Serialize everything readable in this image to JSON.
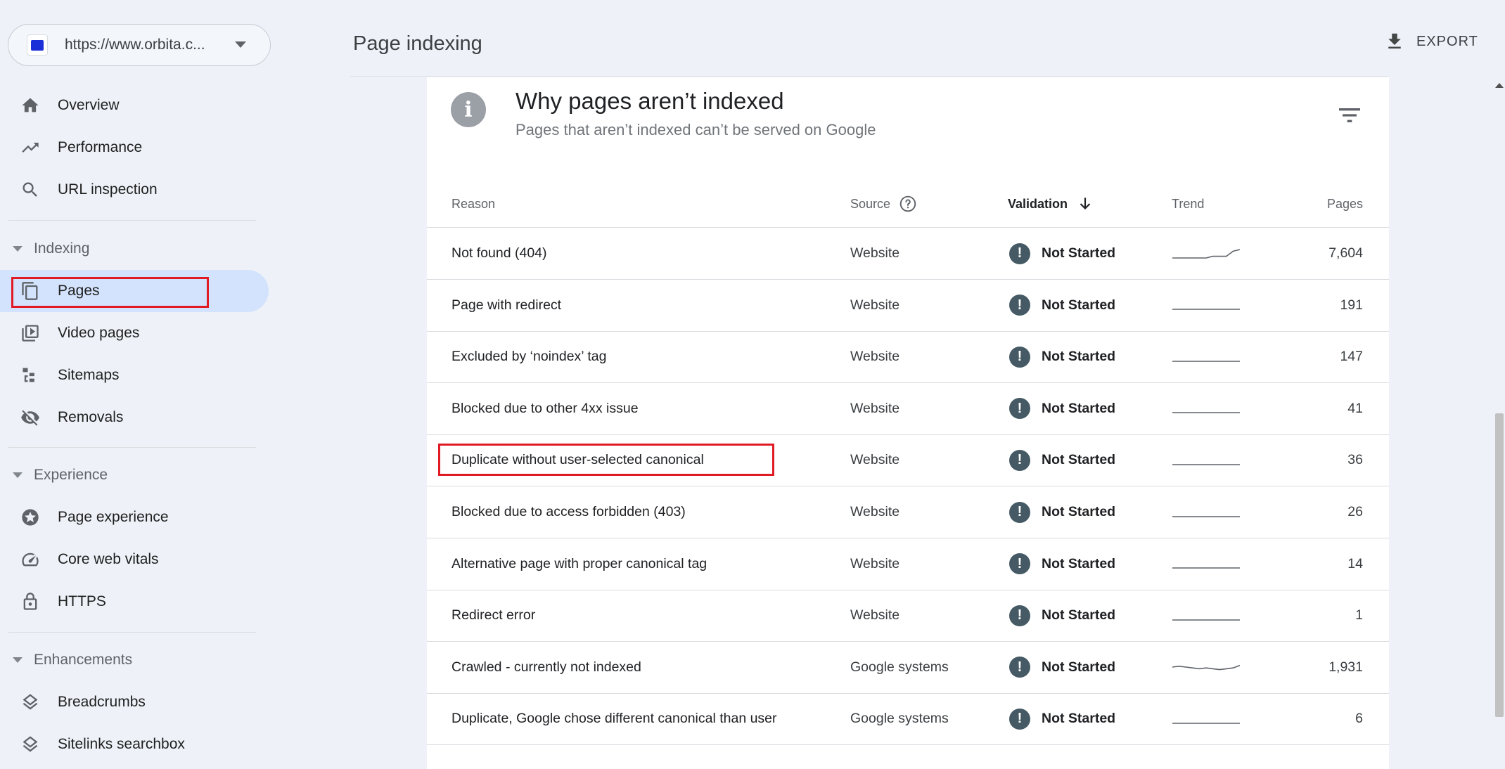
{
  "property": {
    "url": "https://www.orbita.c..."
  },
  "nav": {
    "overview": "Overview",
    "performance": "Performance",
    "url_inspection": "URL inspection",
    "indexing_section": "Indexing",
    "pages": "Pages",
    "video_pages": "Video pages",
    "sitemaps": "Sitemaps",
    "removals": "Removals",
    "experience_section": "Experience",
    "page_experience": "Page experience",
    "core_web_vitals": "Core web vitals",
    "https": "HTTPS",
    "enhancements_section": "Enhancements",
    "breadcrumbs": "Breadcrumbs",
    "sitelinks_searchbox": "Sitelinks searchbox"
  },
  "header": {
    "title": "Page indexing",
    "export_label": "EXPORT"
  },
  "card": {
    "title": "Why pages aren’t indexed",
    "subtitle": "Pages that aren’t indexed can’t be served on Google",
    "info_glyph": "i"
  },
  "table": {
    "columns": {
      "reason": "Reason",
      "source": "Source",
      "validation": "Validation",
      "trend": "Trend",
      "pages": "Pages"
    },
    "warn_glyph": "!",
    "rows": [
      {
        "reason": "Not found (404)",
        "source": "Website",
        "validation": "Not Started",
        "pages": "7,604",
        "trend": [
          1,
          1,
          1,
          1,
          1,
          1,
          0.8,
          0.8,
          0.8,
          0.2,
          0
        ]
      },
      {
        "reason": "Page with redirect",
        "source": "Website",
        "validation": "Not Started",
        "pages": "191",
        "trend": [
          1,
          1,
          1,
          1,
          1,
          1,
          1,
          1,
          1,
          1,
          1
        ]
      },
      {
        "reason": "Excluded by ‘noindex’ tag",
        "source": "Website",
        "validation": "Not Started",
        "pages": "147",
        "trend": [
          1,
          1,
          1,
          1,
          1,
          1,
          1,
          1,
          1,
          1,
          1
        ]
      },
      {
        "reason": "Blocked due to other 4xx issue",
        "source": "Website",
        "validation": "Not Started",
        "pages": "41",
        "trend": [
          1,
          1,
          1,
          1,
          1,
          1,
          1,
          1,
          1,
          1,
          1
        ]
      },
      {
        "reason": "Duplicate without user-selected canonical",
        "source": "Website",
        "validation": "Not Started",
        "pages": "36",
        "trend": [
          1,
          1,
          1,
          1,
          1,
          1,
          1,
          1,
          1,
          1,
          1
        ]
      },
      {
        "reason": "Blocked due to access forbidden (403)",
        "source": "Website",
        "validation": "Not Started",
        "pages": "26",
        "trend": [
          1,
          1,
          1,
          1,
          1,
          1,
          1,
          1,
          1,
          1,
          1
        ]
      },
      {
        "reason": "Alternative page with proper canonical tag",
        "source": "Website",
        "validation": "Not Started",
        "pages": "14",
        "trend": [
          1,
          1,
          1,
          1,
          1,
          1,
          1,
          1,
          1,
          1,
          1
        ]
      },
      {
        "reason": "Redirect error",
        "source": "Website",
        "validation": "Not Started",
        "pages": "1",
        "trend": [
          1,
          1,
          1,
          1,
          1,
          1,
          1,
          1,
          1,
          1,
          1
        ]
      },
      {
        "reason": "Crawled - currently not indexed",
        "source": "Google systems",
        "validation": "Not Started",
        "pages": "1,931",
        "trend": [
          0.5,
          0.4,
          0.5,
          0.6,
          0.7,
          0.6,
          0.7,
          0.8,
          0.7,
          0.6,
          0.3
        ]
      },
      {
        "reason": "Duplicate, Google chose different canonical than user",
        "source": "Google systems",
        "validation": "Not Started",
        "pages": "6",
        "trend": [
          1,
          1,
          1,
          1,
          1,
          1,
          1,
          1,
          1,
          1,
          1
        ]
      }
    ]
  },
  "colors": {
    "accent_nav": "#d3e3fd",
    "highlight_box": "#e01b24",
    "warn_icon": "#455a64",
    "trend_line": "#5f6368"
  }
}
